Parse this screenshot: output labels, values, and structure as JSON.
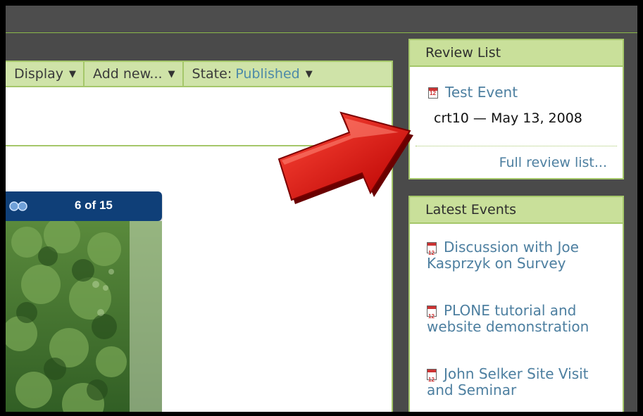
{
  "toolbar": {
    "display_label": "Display",
    "addnew_label": "Add new...",
    "state_label": "State:",
    "state_value": "Published"
  },
  "slideshow": {
    "counter": "6 of 15"
  },
  "review_list": {
    "title": "Review List",
    "item": {
      "icon": "calendar-icon",
      "title": "Test Event",
      "meta": "crt10 — May 13, 2008"
    },
    "footer_link": "Full review list..."
  },
  "latest_events": {
    "title": "Latest Events",
    "items": [
      {
        "icon": "calendar-icon",
        "title": "Discussion with Joe Kasprzyk on Survey"
      },
      {
        "icon": "calendar-icon",
        "title": "PLONE tutorial and website demonstration"
      },
      {
        "icon": "calendar-icon",
        "title": "John Selker Site Visit and Seminar"
      }
    ]
  },
  "colors": {
    "portlet_header": "#c9e09a",
    "border_green": "#a5c76a",
    "link_blue": "#4d7fa0",
    "slideshow_bar": "#0f3f78",
    "arrow_red": "#e01010"
  }
}
